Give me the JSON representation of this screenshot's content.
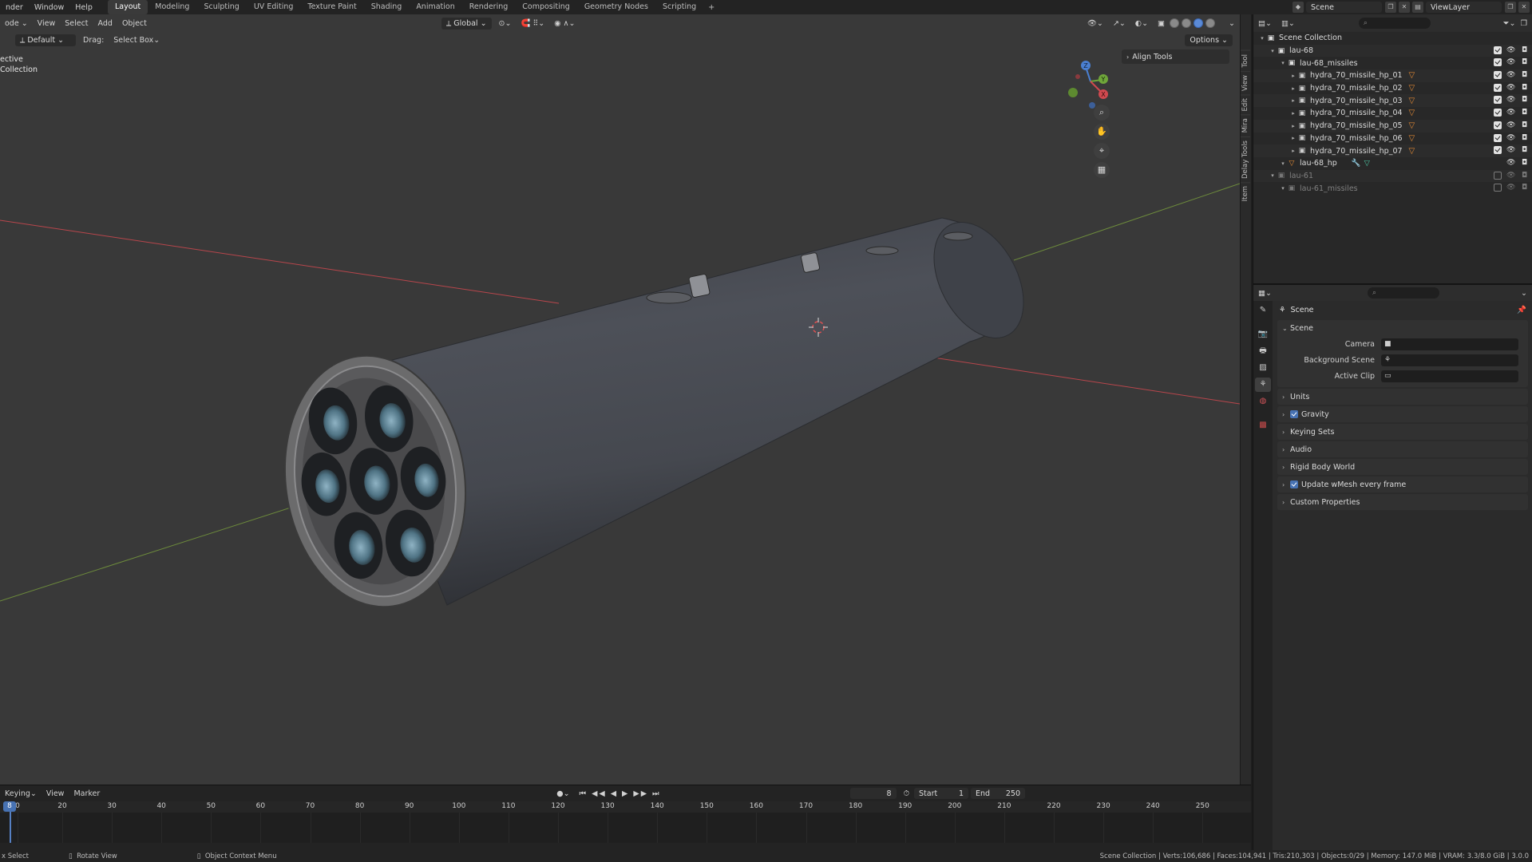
{
  "topbar": {
    "menus": [
      "nder",
      "Window",
      "Help"
    ],
    "workspaces": [
      "Layout",
      "Modeling",
      "Sculpting",
      "UV Editing",
      "Texture Paint",
      "Shading",
      "Animation",
      "Rendering",
      "Compositing",
      "Geometry Nodes",
      "Scripting"
    ],
    "active_workspace": "Layout",
    "add_tab": "+",
    "scene": "Scene",
    "view_layer": "ViewLayer"
  },
  "viewport": {
    "mode": "ode",
    "menus": [
      "View",
      "Select",
      "Add",
      "Object"
    ],
    "orientation": "Global",
    "orientation_label": "Default",
    "drag_label": "Drag:",
    "drag_value": "Select Box",
    "options": "Options",
    "overlay_line1": "ective",
    "overlay_line2": "Collection",
    "align_tools": "Align Tools",
    "gizmo": {
      "z": "Z",
      "y": "Y",
      "x": "X"
    },
    "n_tabs": [
      "Tool",
      "View",
      "Edit",
      "Mira",
      "Delay Tools",
      "Item"
    ],
    "colors": {
      "background": "#393939",
      "x_axis": "#b8464c",
      "y_axis": "#6d8b3c"
    }
  },
  "timeline": {
    "menus": [
      "Keying",
      "View",
      "Marker"
    ],
    "current_frame": "8",
    "start_label": "Start",
    "start_value": "1",
    "end_label": "End",
    "end_value": "250",
    "playhead_label": "8",
    "ticks": [
      "0",
      "20",
      "30",
      "40",
      "50",
      "60",
      "70",
      "80",
      "90",
      "100",
      "110",
      "120",
      "130",
      "140",
      "150",
      "160",
      "170",
      "180",
      "190",
      "200",
      "210",
      "220",
      "230",
      "240",
      "250"
    ]
  },
  "statusbar": {
    "select": "x Select",
    "rotate": "Rotate View",
    "context": "Object Context Menu",
    "stats": "Scene Collection | Verts:106,686 | Faces:104,941 | Tris:210,303 | Objects:0/29 | Memory: 147.0 MiB | VRAM: 3.3/8.0 GiB | 3.0.0"
  },
  "outliner": {
    "search_placeholder": "",
    "rows": [
      {
        "label": "Scene Collection",
        "indent": 0,
        "icon": "collection",
        "dim": false,
        "toggles": false
      },
      {
        "label": "lau-68",
        "indent": 1,
        "icon": "collection",
        "dim": false,
        "toggles": true,
        "checked": true
      },
      {
        "label": "lau-68_missiles",
        "indent": 2,
        "icon": "collection",
        "dim": false,
        "toggles": true,
        "checked": true
      },
      {
        "label": "hydra_70_missile_hp_01",
        "indent": 3,
        "icon": "object",
        "dim": false,
        "toggles": true,
        "checked": true,
        "mesh": true
      },
      {
        "label": "hydra_70_missile_hp_02",
        "indent": 3,
        "icon": "object",
        "dim": false,
        "toggles": true,
        "checked": true,
        "mesh": true
      },
      {
        "label": "hydra_70_missile_hp_03",
        "indent": 3,
        "icon": "object",
        "dim": false,
        "toggles": true,
        "checked": true,
        "mesh": true
      },
      {
        "label": "hydra_70_missile_hp_04",
        "indent": 3,
        "icon": "object",
        "dim": false,
        "toggles": true,
        "checked": true,
        "mesh": true
      },
      {
        "label": "hydra_70_missile_hp_05",
        "indent": 3,
        "icon": "object",
        "dim": false,
        "toggles": true,
        "checked": true,
        "mesh": true
      },
      {
        "label": "hydra_70_missile_hp_06",
        "indent": 3,
        "icon": "object",
        "dim": false,
        "toggles": true,
        "checked": true,
        "mesh": true
      },
      {
        "label": "hydra_70_missile_hp_07",
        "indent": 3,
        "icon": "object",
        "dim": false,
        "toggles": true,
        "checked": true,
        "mesh": true
      },
      {
        "label": "lau-68_hp",
        "indent": 2,
        "icon": "mesh",
        "dim": false,
        "toggles": true,
        "checked": null
      },
      {
        "label": "lau-61",
        "indent": 1,
        "icon": "collection",
        "dim": true,
        "toggles": true,
        "checked": false
      },
      {
        "label": "lau-61_missiles",
        "indent": 2,
        "icon": "collection",
        "dim": true,
        "toggles": true,
        "checked": false
      }
    ]
  },
  "properties": {
    "context": "Scene",
    "panel_title": "Scene",
    "fields": [
      {
        "label": "Camera",
        "value": ""
      },
      {
        "label": "Background Scene",
        "value": ""
      },
      {
        "label": "Active Clip",
        "value": ""
      }
    ],
    "subpanels": [
      {
        "label": "Units",
        "checkbox": false
      },
      {
        "label": "Gravity",
        "checkbox": true
      },
      {
        "label": "Keying Sets",
        "checkbox": false
      },
      {
        "label": "Audio",
        "checkbox": false
      },
      {
        "label": "Rigid Body World",
        "checkbox": false
      },
      {
        "label": "Update wMesh every frame",
        "checkbox": true
      },
      {
        "label": "Custom Properties",
        "checkbox": false
      }
    ]
  }
}
